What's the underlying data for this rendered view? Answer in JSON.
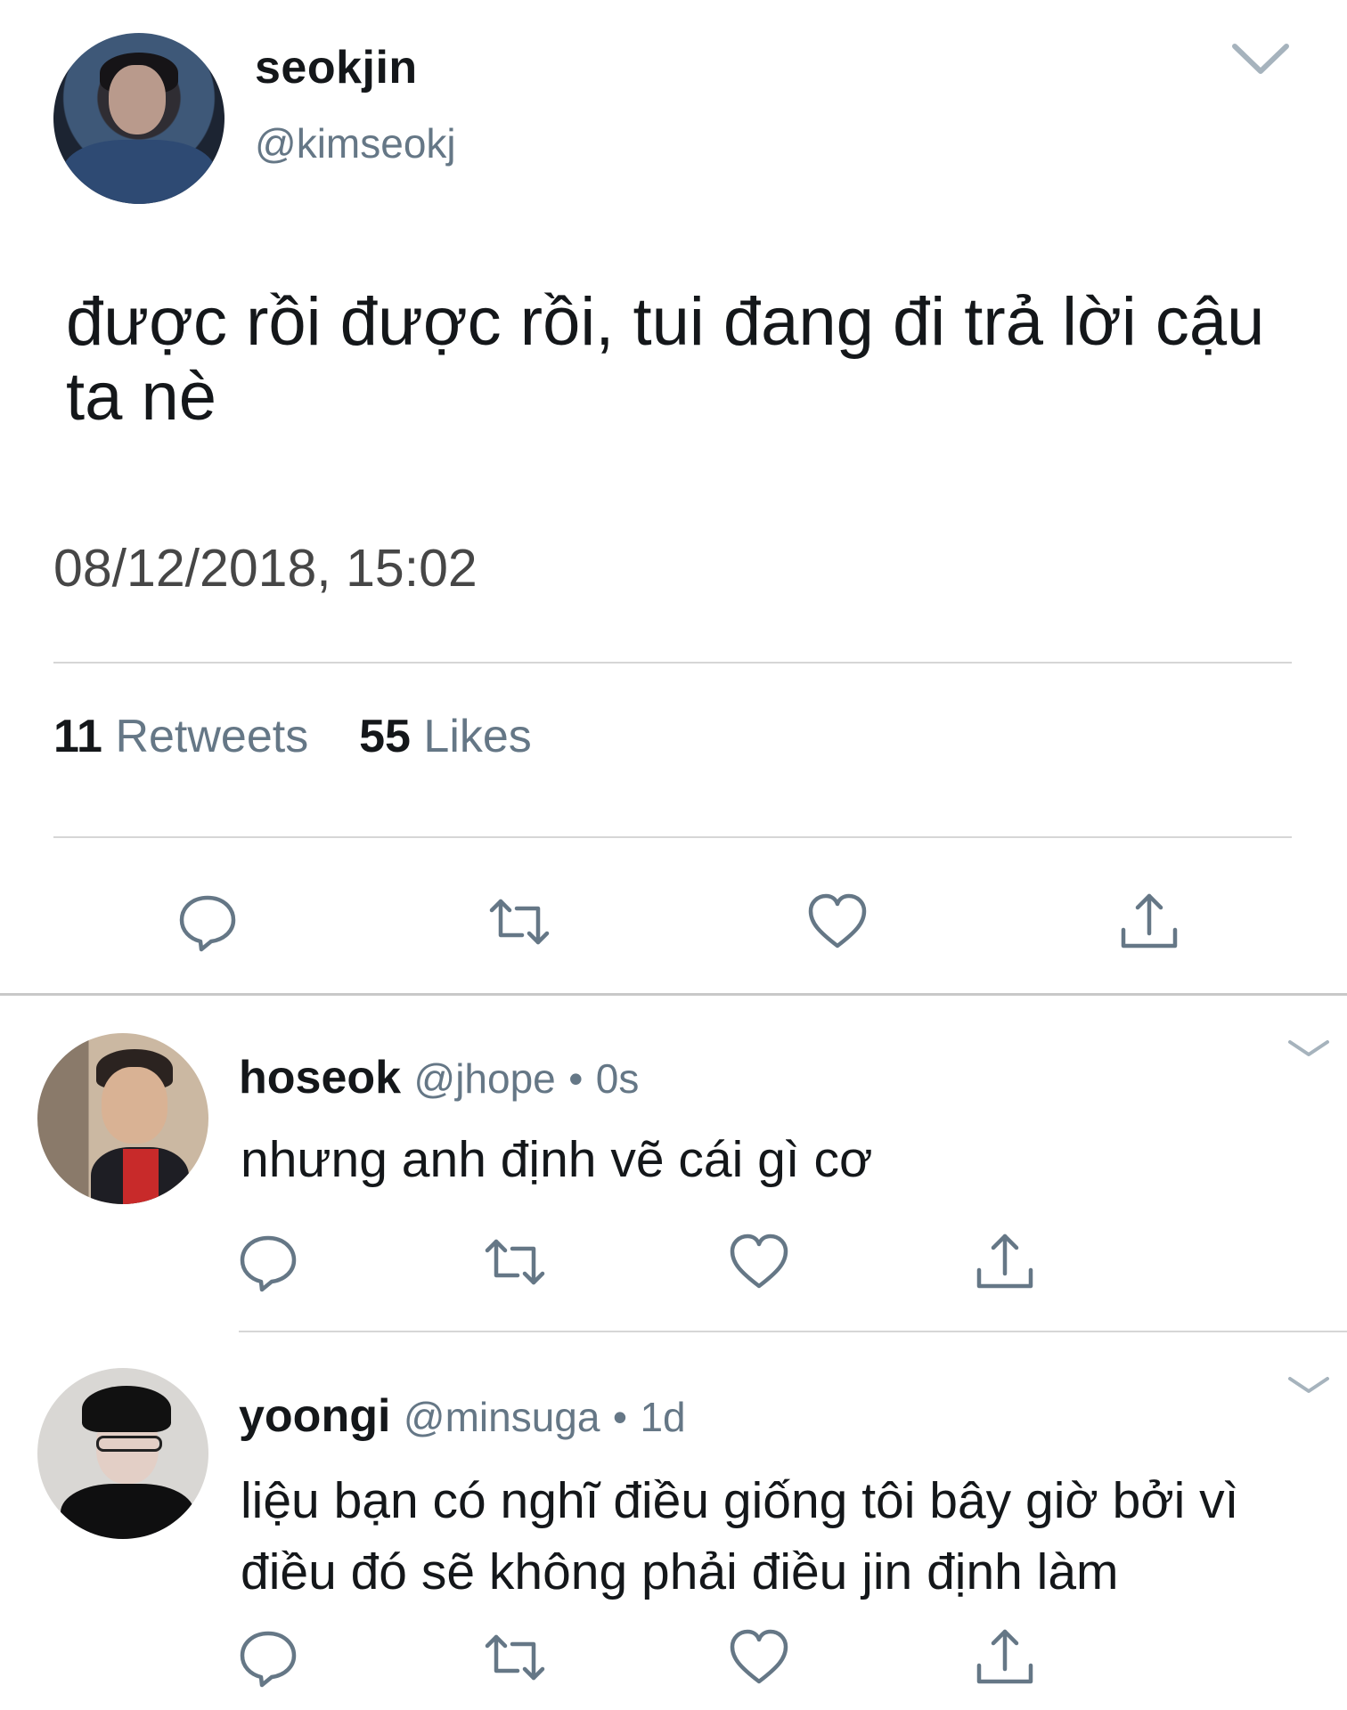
{
  "tweet": {
    "display_name": "seokjin",
    "handle": "@kimseokj",
    "text": "được rồi được rồi, tui đang đi trả lời cậu ta nè",
    "timestamp": "08/12/2018, 15:02",
    "retweet_count": "11",
    "retweet_label": "Retweets",
    "like_count": "55",
    "like_label": "Likes"
  },
  "replies": [
    {
      "display_name": "hoseok",
      "handle": "@jhope",
      "separator": "•",
      "time": "0s",
      "text": "nhưng anh định vẽ cái gì cơ"
    },
    {
      "display_name": "yoongi",
      "handle": "@minsuga",
      "separator": "•",
      "time": "1d",
      "text": "liệu bạn có nghĩ điều giống tôi bây giờ bởi vì điều đó sẽ không phải điều jin định làm"
    }
  ],
  "icons": {
    "reply": "reply-icon",
    "retweet": "retweet-icon",
    "like": "heart-icon",
    "share": "share-icon",
    "more": "chevron-down-icon"
  },
  "colors": {
    "text_primary": "#14171a",
    "text_secondary": "#657786",
    "icon": "#657786",
    "divider": "#d6d6d6"
  }
}
